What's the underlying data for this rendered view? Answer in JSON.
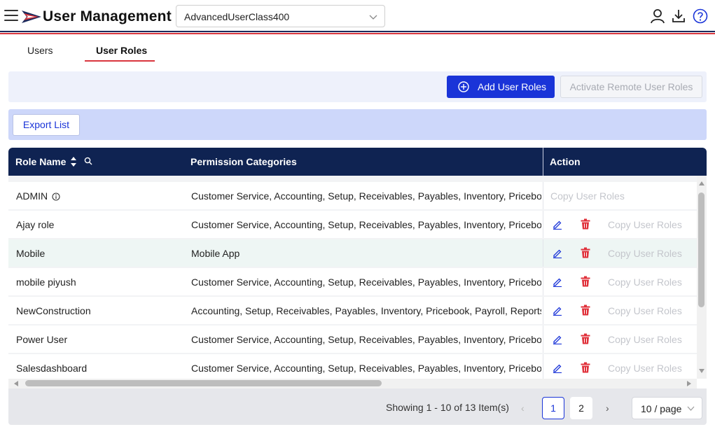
{
  "header": {
    "title": "User Management",
    "company_select": "AdvancedUserClass400",
    "colors": {
      "navy": "#1b2a5c",
      "red": "#d9363e",
      "help": "#1a34d8"
    },
    "icons": [
      "menu-icon",
      "logo-icon",
      "user-icon",
      "download-icon",
      "help-icon"
    ]
  },
  "tabs": [
    {
      "label": "Users",
      "active": false
    },
    {
      "label": "User Roles",
      "active": true
    }
  ],
  "toolbar": {
    "add_label": "Add User Roles",
    "activate_label": "Activate Remote User Roles",
    "export_label": "Export List"
  },
  "table": {
    "columns": [
      "Role Name",
      "Permission Categories",
      "Action"
    ],
    "copy_label": "Copy User Roles",
    "rows": [
      {
        "name": "ADMIN",
        "permissions": "Customer Service, Accounting, Setup, Receivables, Payables, Inventory, Pricebook, Payroll",
        "has_info": true,
        "actions": "copy-only"
      },
      {
        "name": "Ajay role",
        "permissions": "Customer Service, Accounting, Setup, Receivables, Payables, Inventory, Pricebook, Payroll",
        "actions": "full"
      },
      {
        "name": "Mobile",
        "permissions": "Mobile App",
        "actions": "full",
        "highlighted": true
      },
      {
        "name": "mobile piyush",
        "permissions": "Customer Service, Accounting, Setup, Receivables, Payables, Inventory, Pricebook, Payroll",
        "actions": "full"
      },
      {
        "name": "NewConstruction",
        "permissions": "Accounting, Setup, Receivables, Payables, Inventory, Pricebook, Payroll, Reports, Purchasing",
        "actions": "full"
      },
      {
        "name": "Power User",
        "permissions": "Customer Service, Accounting, Setup, Receivables, Payables, Inventory, Pricebook, Payroll",
        "actions": "full"
      },
      {
        "name": "Salesdashboard",
        "permissions": "Customer Service, Accounting, Setup, Receivables, Payables, Inventory, Pricebook, Payroll",
        "actions": "full"
      }
    ]
  },
  "pagination": {
    "showing": "Showing 1 - 10 of 13 Item(s)",
    "pages": [
      "1",
      "2"
    ],
    "current": "1",
    "page_size": "10 / page"
  }
}
